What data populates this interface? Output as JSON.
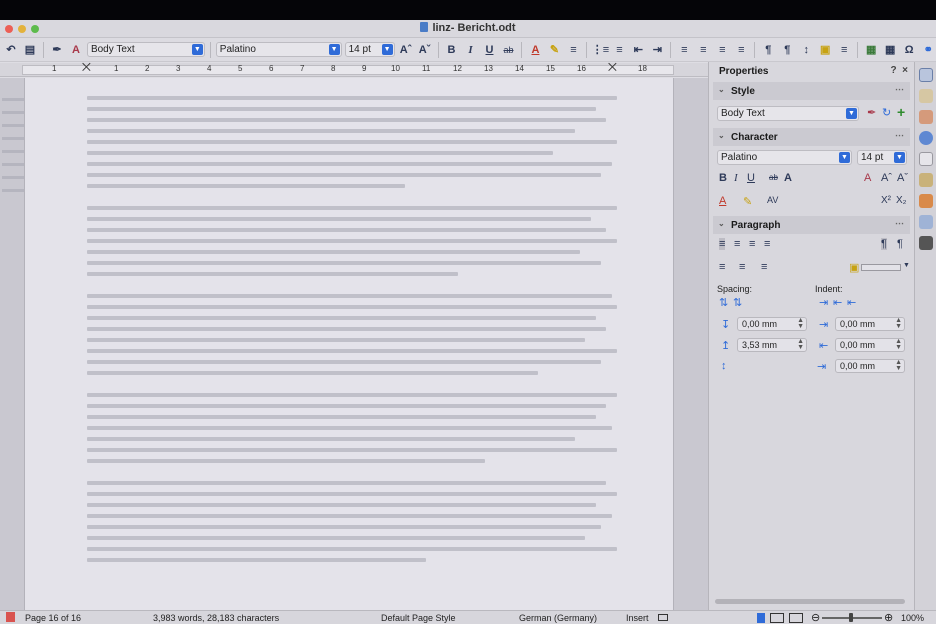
{
  "window": {
    "title": "linz- Bericht.odt"
  },
  "toolbar": {
    "paragraph_style": "Body Text",
    "font_name": "Palatino",
    "font_size": "14 pt",
    "bold": "B",
    "italic": "I",
    "underline": "U",
    "strike": "ab",
    "font_color": "A",
    "grow_font": "Aˆ",
    "shrink_font": "Aˇ",
    "special_char": "Ω"
  },
  "ruler": {
    "ticks": [
      "1",
      "1",
      "2",
      "3",
      "4",
      "5",
      "6",
      "7",
      "8",
      "9",
      "10",
      "11",
      "12",
      "13",
      "14",
      "15",
      "16",
      "17",
      "18"
    ]
  },
  "sidebar": {
    "title": "Properties",
    "help": "?",
    "close": "×",
    "style_section": "Style",
    "style_value": "Body Text",
    "character_section": "Character",
    "font_name": "Palatino",
    "font_size": "14 pt",
    "bold": "B",
    "italic": "I",
    "underline": "U",
    "strike": "ab",
    "shadow": "A",
    "superscript": "X²",
    "subscript": "X₂",
    "paragraph_section": "Paragraph",
    "spacing_label": "Spacing:",
    "indent_label": "Indent:",
    "above_spacing": "0,00 mm",
    "below_spacing": "3,53 mm",
    "before_indent": "0,00 mm",
    "after_indent": "0,00 mm",
    "first_line_indent": "0,00 mm"
  },
  "status": {
    "page": "Page 16 of 16",
    "words": "3,983 words, 28,183 characters",
    "page_style": "Default Page Style",
    "language": "German (Germany)",
    "mode": "Insert",
    "zoom": "100%"
  },
  "colors": {
    "accent": "#2f6bd8",
    "close": "#ec5f56",
    "minimize": "#e3b23c",
    "maximize": "#5dbb4c"
  }
}
